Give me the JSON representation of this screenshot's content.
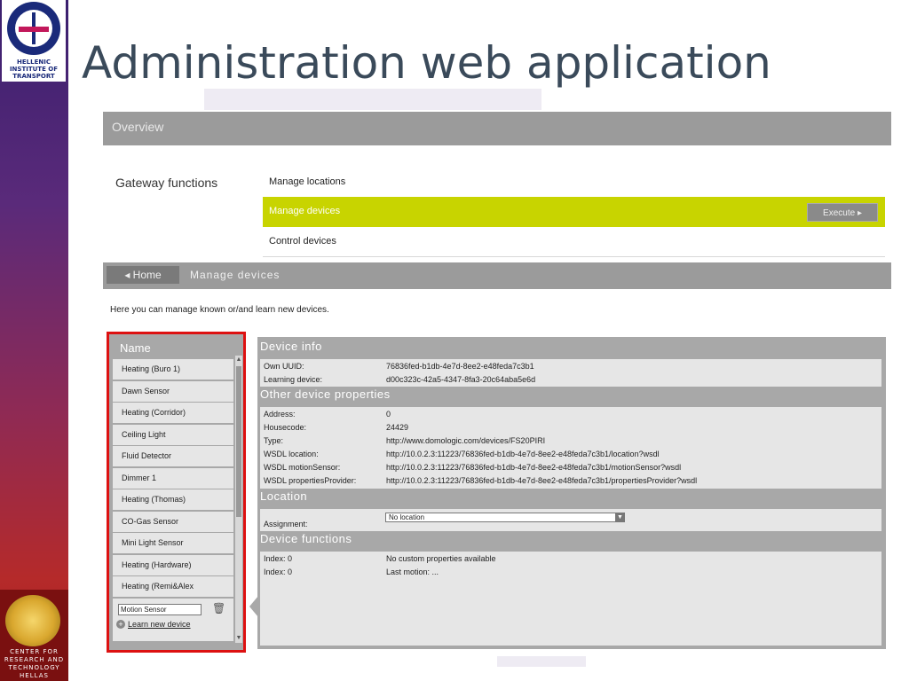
{
  "slide": {
    "title": "Administration web application",
    "logo_top_text": "HELLENIC INSTITUTE OF TRANSPORT",
    "logo_bottom_text": "CENTER FOR RESEARCH AND TECHNOLOGY HELLAS"
  },
  "header": {
    "title": "Overview"
  },
  "gateway": {
    "label": "Gateway functions",
    "functions": [
      {
        "label": "Manage locations"
      },
      {
        "label": "Manage devices",
        "action": "Execute ▸"
      },
      {
        "label": "Control devices"
      }
    ]
  },
  "nav": {
    "home_label": "◂ Home",
    "title": "Manage devices"
  },
  "intro": "Here you can manage known or/and learn new devices.",
  "devices": {
    "header": "Name",
    "items": [
      "Heating (Buro 1)",
      "Dawn Sensor",
      "Heating (Corridor)",
      "Ceiling Light",
      "Fluid Detector",
      "Dimmer 1",
      "Heating (Thomas)",
      "CO-Gas Sensor",
      "Mini Light Sensor",
      "Heating (Hardware)",
      "Heating (Remi&Alex"
    ],
    "edit_value": "Motion Sensor",
    "learn_label": "Learn new device"
  },
  "device_info": {
    "title": "Device info",
    "rows": [
      {
        "key": "Own UUID:",
        "value": "76836fed-b1db-4e7d-8ee2-e48feda7c3b1"
      },
      {
        "key": "Learning device:",
        "value": "d00c323c-42a5-4347-8fa3-20c64aba5e6d"
      }
    ]
  },
  "other_properties": {
    "title": "Other device properties",
    "rows": [
      {
        "key": "Address:",
        "value": "0"
      },
      {
        "key": "Housecode:",
        "value": "24429"
      },
      {
        "key": "Type:",
        "value": "http://www.domologic.com/devices/FS20PIRI"
      },
      {
        "key": "WSDL location:",
        "value": "http://10.0.2.3:11223/76836fed-b1db-4e7d-8ee2-e48feda7c3b1/location?wsdl"
      },
      {
        "key": "WSDL motionSensor:",
        "value": "http://10.0.2.3:11223/76836fed-b1db-4e7d-8ee2-e48feda7c3b1/motionSensor?wsdl"
      },
      {
        "key": "WSDL propertiesProvider:",
        "value": "http://10.0.2.3:11223/76836fed-b1db-4e7d-8ee2-e48feda7c3b1/propertiesProvider?wsdl"
      }
    ]
  },
  "location": {
    "title": "Location",
    "assignment_label": "Assignment:",
    "selected": "No location"
  },
  "device_functions": {
    "title": "Device functions",
    "rows": [
      {
        "key": "Index: 0",
        "value": "No custom properties available"
      },
      {
        "key": "Index: 0",
        "value": "Last motion: ..."
      }
    ]
  },
  "colors": {
    "accent": "#c8d400",
    "panel_gray": "#9b9b9b",
    "highlight_border": "#dd1111"
  }
}
